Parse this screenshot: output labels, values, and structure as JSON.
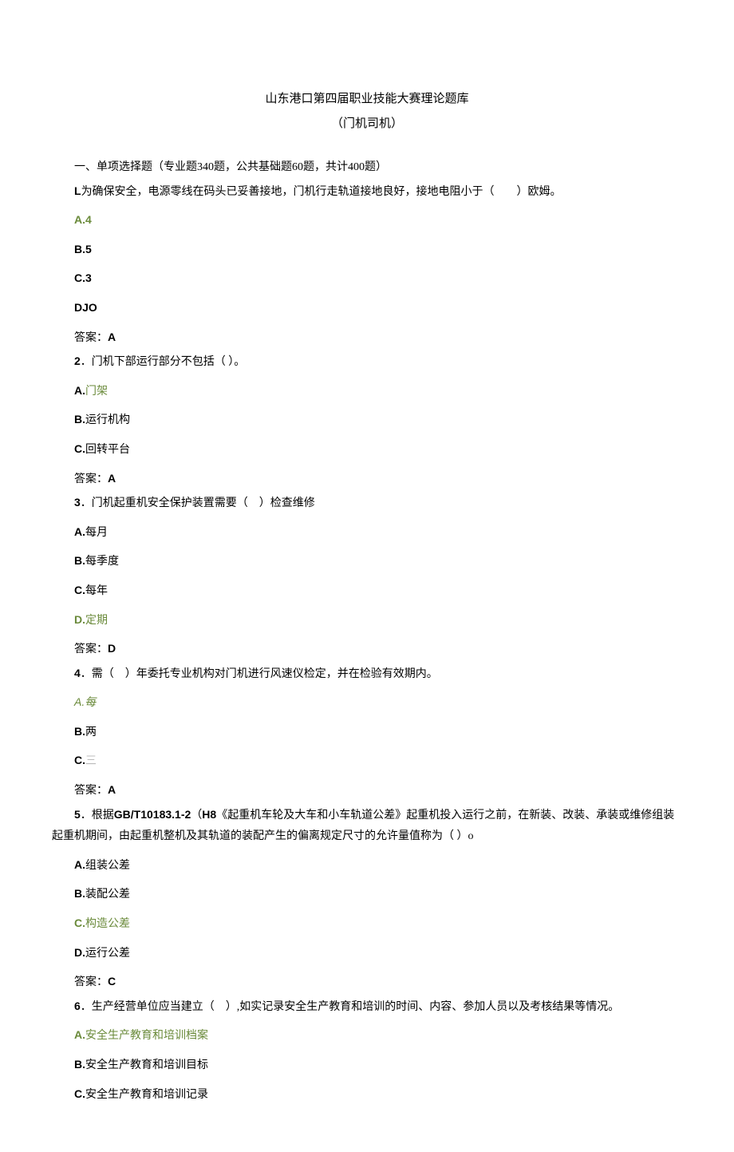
{
  "title": "山东港口第四届职业技能大赛理论题库",
  "subtitle": "（门机司机）",
  "section": "一、单项选择题（专业题340题，公共基础题60题，共计400题）",
  "questions": [
    {
      "num": "L",
      "stem_before": "为确保安全，电源零线在码头已妥善接地，门机行走轨道接地良好，接地电阻小于（　　）欧姆。",
      "options": [
        {
          "label": "A.",
          "text": "4",
          "highlight": true
        },
        {
          "label": "B.",
          "text": "5",
          "highlight": false
        },
        {
          "label": "C.",
          "text": "3",
          "highlight": false
        },
        {
          "label": "DJO",
          "text": "",
          "highlight": false
        }
      ],
      "answer_label": "答案：",
      "answer": "A"
    },
    {
      "num": "2",
      "stem_before": "．门机下部运行部分不包括（ ）。",
      "options": [
        {
          "label": "A.",
          "text": "门架",
          "highlight": true
        },
        {
          "label": "B.",
          "text": "运行机构",
          "highlight": false
        },
        {
          "label": "C.",
          "text": "回转平台",
          "highlight": false
        }
      ],
      "answer_label": "答案：",
      "answer": "A"
    },
    {
      "num": "3",
      "stem_before": "．门机起重机安全保护装置需要（　）检查维修",
      "options": [
        {
          "label": "A.",
          "text": "每月",
          "highlight": false
        },
        {
          "label": "B.",
          "text": "每季度",
          "highlight": false
        },
        {
          "label": "C.",
          "text": "每年",
          "highlight": false
        },
        {
          "label": "D.",
          "text": "定期",
          "highlight": true
        }
      ],
      "answer_label": "答案：",
      "answer": "D"
    },
    {
      "num": "4",
      "stem_before": "．需（　）年委托专业机构对门机进行风速仪检定，并在检验有效期内。",
      "options": [
        {
          "label": "A.",
          "text": "每",
          "highlight": true,
          "italic": true
        },
        {
          "label": "B.",
          "text": "两",
          "highlight": false
        },
        {
          "label": "C.",
          "text": "三",
          "highlight": false,
          "faded": true
        }
      ],
      "answer_label": "答案：",
      "answer": "A"
    },
    {
      "num": "5",
      "stem_line1_a": "．根据",
      "stem_line1_b": "GB/T10183.1-2",
      "stem_line1_c": "（",
      "stem_line1_d": "H8",
      "stem_line1_e": "《起重机车轮及大车和小车轨道公差》起重机投入运行之前，在新装、改装、承装或维修组装",
      "stem_line2": "起重机期间，由起重机整机及其轨道的装配产生的偏离规定尺寸的允许量值称为（ ）o",
      "options": [
        {
          "label": "A.",
          "text": "组装公差",
          "highlight": false
        },
        {
          "label": "B.",
          "text": "装配公差",
          "highlight": false
        },
        {
          "label": "C.",
          "text": "构造公差",
          "highlight": true
        },
        {
          "label": "D.",
          "text": "运行公差",
          "highlight": false
        }
      ],
      "answer_label": "答案：",
      "answer": "C"
    },
    {
      "num": "6",
      "stem_before": "．生产经营单位应当建立（　）,如实记录安全生产教育和培训的时间、内容、参加人员以及考核结果等情况。",
      "options": [
        {
          "label": "A.",
          "text": "安全生产教育和培训档案",
          "highlight": true
        },
        {
          "label": "B.",
          "text": "安全生产教育和培训目标",
          "highlight": false
        },
        {
          "label": "C.",
          "text": "安全生产教育和培训记录",
          "highlight": false
        }
      ]
    }
  ]
}
